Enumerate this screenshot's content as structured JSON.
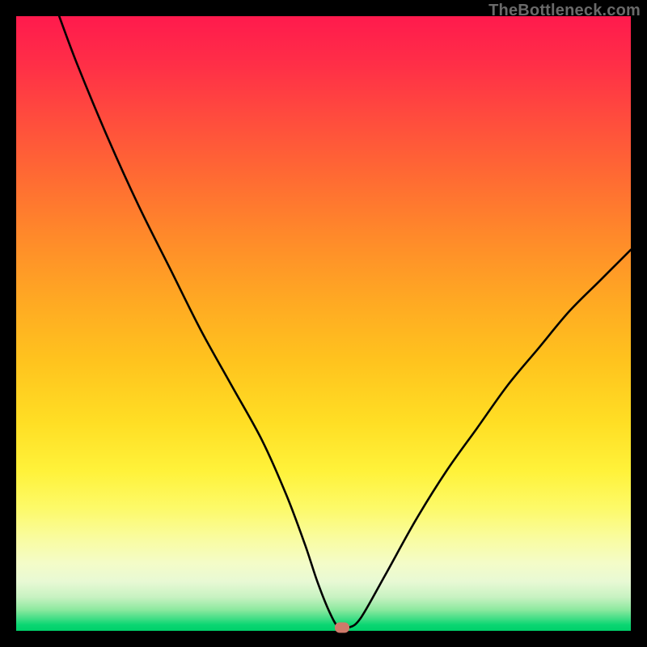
{
  "attribution": "TheBottleneck.com",
  "chart_data": {
    "type": "line",
    "title": "",
    "xlabel": "",
    "ylabel": "",
    "xlim": [
      0,
      100
    ],
    "ylim": [
      0,
      100
    ],
    "series": [
      {
        "name": "bottleneck-curve",
        "x": [
          7,
          10,
          15,
          20,
          25,
          30,
          35,
          40,
          44,
          47,
          49,
          51,
          52.5,
          54,
          56,
          60,
          65,
          70,
          75,
          80,
          85,
          90,
          95,
          100
        ],
        "y": [
          100,
          92,
          80,
          69,
          59,
          49,
          40,
          31,
          22,
          14,
          8,
          3,
          0.5,
          0.5,
          2,
          9,
          18,
          26,
          33,
          40,
          46,
          52,
          57,
          62
        ]
      }
    ],
    "marker": {
      "x": 53,
      "y": 0.5,
      "color": "#cf7a6a"
    },
    "gradient_stops": [
      {
        "pos": 0,
        "color": "#ff1a4d"
      },
      {
        "pos": 50,
        "color": "#ffbf20"
      },
      {
        "pos": 80,
        "color": "#fdf95a"
      },
      {
        "pos": 100,
        "color": "#00d06a"
      }
    ]
  }
}
